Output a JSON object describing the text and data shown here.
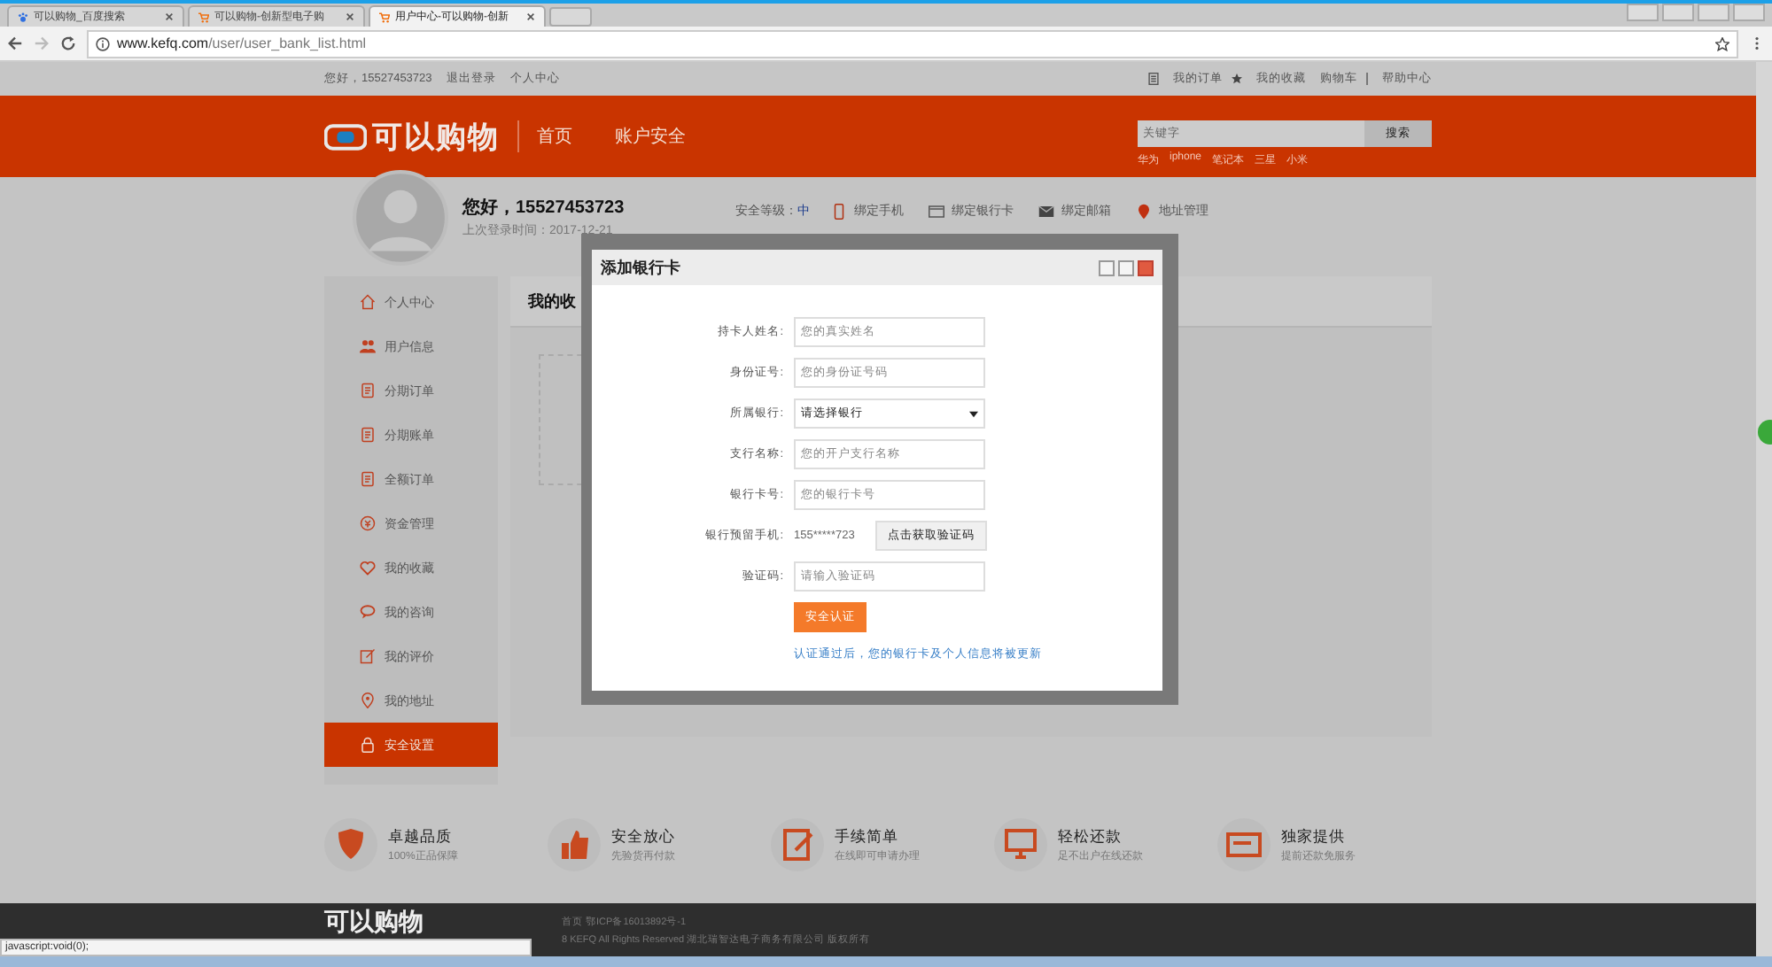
{
  "browser": {
    "tabs": [
      {
        "title": "可以购物_百度搜索",
        "selected": false
      },
      {
        "title": "可以购物-创新型电子购",
        "selected": false
      },
      {
        "title": "用户中心-可以购物-创新",
        "selected": true
      }
    ],
    "url": {
      "host": "www.kefq.com",
      "path": "/user/user_bank_list.html"
    },
    "status_text": "javascript:void(0);"
  },
  "top_bar": {
    "greeting": "您好，15527453723",
    "links": [
      "退出登录",
      "个人中心"
    ],
    "right_links": [
      "我的订单",
      "我的收藏",
      "购物车",
      "帮助中心"
    ]
  },
  "header": {
    "logo": "可以购物",
    "nav": [
      "首页",
      "账户安全"
    ],
    "search": {
      "placeholder": "关键字",
      "button": "搜索"
    },
    "hot_words": [
      "华为",
      "iphone",
      "笔记本",
      "三星",
      "小米"
    ]
  },
  "user": {
    "greeting": "您好，15527453723",
    "last_login": "上次登录时间：2017-12-21",
    "security_label": "安全等级：",
    "security_level": "中",
    "bindings": [
      "绑定手机",
      "绑定银行卡",
      "绑定邮箱",
      "地址管理"
    ]
  },
  "sidebar": {
    "items": [
      {
        "label": "个人中心",
        "selected": false
      },
      {
        "label": "用户信息",
        "selected": false
      },
      {
        "label": "分期订单",
        "selected": false
      },
      {
        "label": "分期账单",
        "selected": false
      },
      {
        "label": "全额订单",
        "selected": false
      },
      {
        "label": "资金管理",
        "selected": false
      },
      {
        "label": "我的收藏",
        "selected": false
      },
      {
        "label": "我的咨询",
        "selected": false
      },
      {
        "label": "我的评价",
        "selected": false
      },
      {
        "label": "我的地址",
        "selected": false
      },
      {
        "label": "安全设置",
        "selected": true
      }
    ]
  },
  "main": {
    "title": "我的收"
  },
  "dialog": {
    "title": "添加银行卡",
    "fields": [
      {
        "kind": "input",
        "label": "持卡人姓名:",
        "placeholder": "您的真实姓名"
      },
      {
        "kind": "input",
        "label": "身份证号:",
        "placeholder": "您的身份证号码"
      },
      {
        "kind": "select",
        "label": "所属银行:",
        "value": "请选择银行"
      },
      {
        "kind": "input",
        "label": "支行名称:",
        "placeholder": "您的开户支行名称"
      },
      {
        "kind": "input",
        "label": "银行卡号:",
        "placeholder": "您的银行卡号"
      },
      {
        "kind": "phone",
        "label": "银行预留手机:",
        "value": "155*****723",
        "button": "点击获取验证码"
      },
      {
        "kind": "input",
        "label": "验证码:",
        "placeholder": "请输入验证码"
      }
    ],
    "submit": "安全认证",
    "note": "认证通过后，您的银行卡及个人信息将被更新"
  },
  "features": [
    {
      "title": "卓越品质",
      "subtitle": "100%正品保障"
    },
    {
      "title": "安全放心",
      "subtitle": "先验货再付款"
    },
    {
      "title": "手续简单",
      "subtitle": "在线即可申请办理"
    },
    {
      "title": "轻松还款",
      "subtitle": "足不出户在线还款"
    },
    {
      "title": "独家提供",
      "subtitle": "提前还款免服务"
    }
  ],
  "footer": {
    "logo": "可以购物",
    "links": "首页  鄂ICP备16013892号-1",
    "copyright": "8 KEFQ All Rights Reserved 湖北瑞智达电子商务有限公司 版权所有"
  }
}
